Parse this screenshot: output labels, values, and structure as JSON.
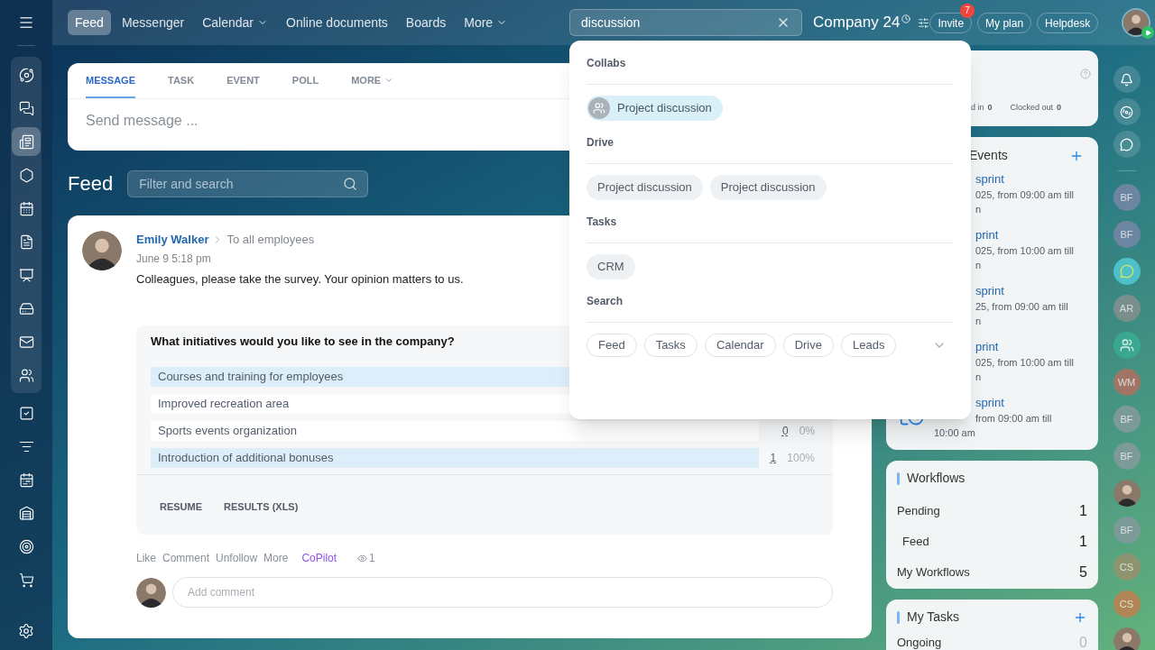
{
  "sidebar": {
    "panel_items": [
      {
        "selected": false
      },
      {
        "selected": false
      },
      {
        "selected": true
      },
      {
        "selected": false
      },
      {
        "selected": false
      },
      {
        "selected": false
      },
      {
        "selected": false
      },
      {
        "selected": false
      },
      {
        "selected": false
      },
      {
        "selected": false
      }
    ],
    "items": [
      {
        "selected": false
      },
      {
        "selected": false
      },
      {
        "selected": false
      },
      {
        "selected": false
      },
      {
        "selected": false
      },
      {
        "selected": false
      }
    ]
  },
  "topbar": {
    "nav": [
      {
        "label": "Feed",
        "selected": true,
        "dropdown": false
      },
      {
        "label": "Messenger",
        "selected": false,
        "dropdown": false
      },
      {
        "label": "Calendar",
        "selected": false,
        "dropdown": true
      },
      {
        "label": "Online documents",
        "selected": false,
        "dropdown": false
      },
      {
        "label": "Boards",
        "selected": false,
        "dropdown": false
      },
      {
        "label": "More",
        "selected": false,
        "dropdown": true
      }
    ],
    "search": {
      "value": "discussion"
    },
    "company": "Company 24",
    "buttons": [
      {
        "label": "Invite",
        "badge": "7"
      },
      {
        "label": "My plan"
      },
      {
        "label": "Helpdesk"
      }
    ]
  },
  "composer": {
    "tabs": [
      {
        "label": "MESSAGE",
        "selected": true,
        "dropdown": false
      },
      {
        "label": "TASK",
        "selected": false,
        "dropdown": false
      },
      {
        "label": "EVENT",
        "selected": false,
        "dropdown": false
      },
      {
        "label": "POLL",
        "selected": false,
        "dropdown": false
      },
      {
        "label": "MORE",
        "selected": false,
        "dropdown": true
      }
    ],
    "placeholder": "Send message ..."
  },
  "feed": {
    "title": "Feed",
    "filter_placeholder": "Filter and search"
  },
  "post": {
    "author": "Emily Walker",
    "recipient": "To all employees",
    "date": "June 9 5:18 pm",
    "text": "Colleagues, please take the survey. Your opinion matters to us.",
    "poll": {
      "question": "What initiatives would you like to see in the company?",
      "options": [
        {
          "label": "Courses and training for employees",
          "selected": true
        },
        {
          "label": "Improved recreation area",
          "selected": false
        },
        {
          "label": "Sports events organization",
          "selected": false,
          "votes": "0",
          "percent": "0%"
        },
        {
          "label": "Introduction of additional bonuses",
          "selected": true,
          "votes": "1",
          "percent": "100%"
        }
      ],
      "buttons": [
        "RESUME",
        "RESULTS (XLS)"
      ]
    },
    "actions": [
      {
        "label": "Like",
        "kind": "plain"
      },
      {
        "label": "Comment",
        "kind": "plain"
      },
      {
        "label": "Unfollow",
        "kind": "plain"
      },
      {
        "label": "More",
        "kind": "plain"
      },
      {
        "label": "CoPilot",
        "kind": "copilot"
      }
    ],
    "views": "1",
    "comment_placeholder": "Add comment"
  },
  "timeman": {
    "stats": [
      {
        "label": "d in",
        "value": "0"
      },
      {
        "label": "Clocked out",
        "value": "0"
      }
    ]
  },
  "events": {
    "title": "Events",
    "items": [
      {
        "title": "sprint",
        "lines": [
          "025, from 09:00 am till",
          "n"
        ]
      },
      {
        "title": "print",
        "lines": [
          "025, from 10:00 am till",
          "n"
        ]
      },
      {
        "title": "sprint",
        "lines": [
          "25, from 09:00 am till",
          "n"
        ]
      },
      {
        "title": "print",
        "lines": [
          "025, from 10:00 am till",
          "n"
        ]
      },
      {
        "title": "sprint",
        "lines": [
          "from 09:00 am till",
          "10:00 am"
        ]
      }
    ]
  },
  "workflows": {
    "title": "Workflows",
    "rows": [
      {
        "label": "Pending",
        "value": "1",
        "indented": false
      },
      {
        "label": "Feed",
        "value": "1",
        "indented": true
      },
      {
        "label": "My Workflows",
        "value": "5",
        "indented": false
      }
    ]
  },
  "tasks": {
    "title": "My Tasks",
    "rows": [
      {
        "label": "Ongoing",
        "value": "0"
      }
    ]
  },
  "rail": [
    {
      "kind": "initials",
      "text": "BF",
      "color": "#6c86a2"
    },
    {
      "kind": "initials",
      "text": "BF",
      "color": "#6c86a2"
    },
    {
      "kind": "chat"
    },
    {
      "kind": "initials",
      "text": "AR",
      "color": "#7a8e8c"
    },
    {
      "kind": "group"
    },
    {
      "kind": "initials",
      "text": "WM",
      "color": "#a07565"
    },
    {
      "kind": "initials",
      "text": "BF",
      "color": "#7c9a98"
    },
    {
      "kind": "initials",
      "text": "BF",
      "color": "#7c9a98"
    },
    {
      "kind": "photo"
    },
    {
      "kind": "initials",
      "text": "BF",
      "color": "#7c9a98"
    },
    {
      "kind": "initials",
      "text": "CS",
      "color": "#8f9470"
    },
    {
      "kind": "initials",
      "text": "CS",
      "color": "#b08656"
    },
    {
      "kind": "photo"
    }
  ],
  "dropdown": {
    "sections": [
      {
        "title": "Collabs",
        "chips": [
          {
            "label": "Project discussion",
            "kind": "collab"
          }
        ]
      },
      {
        "title": "Drive",
        "chips": [
          {
            "label": "Project discussion",
            "kind": "filled"
          },
          {
            "label": "Project discussion",
            "kind": "filled"
          }
        ]
      },
      {
        "title": "Tasks",
        "chips": [
          {
            "label": "CRM",
            "kind": "filled"
          }
        ]
      },
      {
        "title": "Search",
        "chips": [
          {
            "label": "Feed",
            "kind": "outline"
          },
          {
            "label": "Tasks",
            "kind": "outline"
          },
          {
            "label": "Calendar",
            "kind": "outline"
          },
          {
            "label": "Drive",
            "kind": "outline"
          },
          {
            "label": "Leads",
            "kind": "outline"
          }
        ],
        "more": true
      }
    ]
  }
}
